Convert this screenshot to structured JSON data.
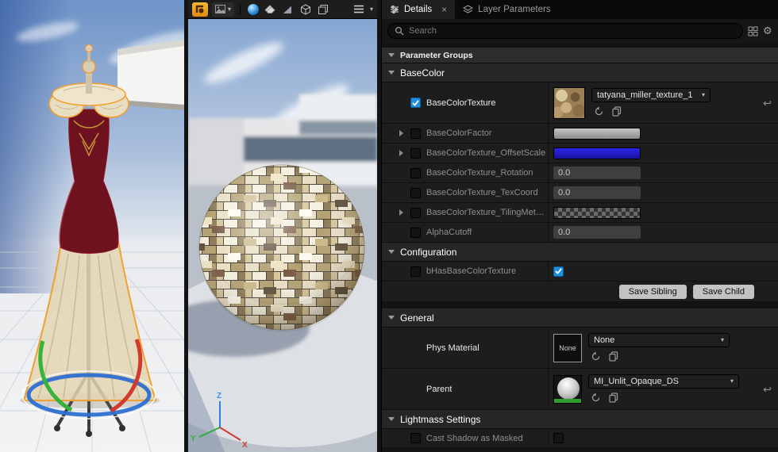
{
  "colors": {
    "accent_blue": "#1f8fe0",
    "selection_orange": "#f0a030",
    "swatch_blue": "#241dd4",
    "swatch_gray": "#b4b4b4"
  },
  "tabs": {
    "details": "Details",
    "layer_parameters": "Layer Parameters"
  },
  "search": {
    "placeholder": "Search"
  },
  "details": {
    "parameter_groups": "Parameter Groups",
    "basecolor": {
      "header": "BaseColor",
      "rows": [
        {
          "label": "BaseColorTexture",
          "value": "tatyana_miller_texture_1"
        },
        {
          "label": "BaseColorFactor"
        },
        {
          "label": "BaseColorTexture_OffsetScale"
        },
        {
          "label": "BaseColorTexture_Rotation",
          "value": "0.0"
        },
        {
          "label": "BaseColorTexture_TexCoord",
          "value": "0.0"
        },
        {
          "label": "BaseColorTexture_TilingMethod"
        },
        {
          "label": "AlphaCutoff",
          "value": "0.0"
        }
      ]
    },
    "configuration": {
      "header": "Configuration",
      "rows": [
        {
          "label": "bHasBaseColorTexture"
        }
      ]
    },
    "buttons": {
      "save_sibling": "Save Sibling",
      "save_child": "Save Child"
    },
    "general": {
      "header": "General",
      "phys_material": {
        "label": "Phys Material",
        "thumb": "None",
        "value": "None"
      },
      "parent": {
        "label": "Parent",
        "value": "MI_Unlit_Opaque_DS"
      }
    },
    "lightmass": {
      "header": "Lightmass Settings",
      "rows": [
        {
          "label": "Cast Shadow as Masked"
        }
      ]
    }
  },
  "viewport": {
    "axis": {
      "x": "X",
      "y": "Y",
      "z": "Z"
    }
  },
  "icons": [
    "select-tool",
    "texture-dropdown",
    "sphere-brush",
    "eraser",
    "falloff",
    "cube",
    "layers",
    "viewport-menu",
    "search",
    "view-options",
    "settings",
    "details-sliders",
    "layer-stack",
    "close",
    "use-selected-asset",
    "browse-to-asset",
    "reset-to-default",
    "chevron-down",
    "expander-arrow"
  ]
}
